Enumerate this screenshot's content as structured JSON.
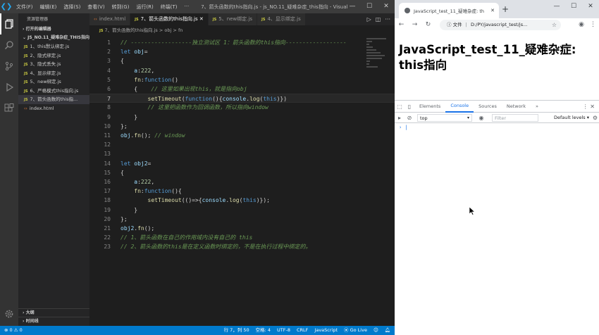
{
  "vscode": {
    "menu": [
      "文件(F)",
      "编辑(E)",
      "选择(S)",
      "查看(V)",
      "转到(G)",
      "运行(R)",
      "终端(T)",
      "···"
    ],
    "window_title": "7、箭头函数的this指向.js - js_NO.11_疑难杂症_this指向 - Visual St...",
    "sidebar": {
      "header": "资源管理器",
      "open_editors": "打开的编辑器",
      "folder": "JS_NO.11_疑难杂症_THIS指向",
      "files": [
        "1、this默认绑定.js",
        "2、隐式绑定.js",
        "3、隐式丢失.js",
        "4、显示绑定.js",
        "5、new绑定.js",
        "6、严格模式this指向.js",
        "7、箭头函数的this指...",
        "index.html"
      ],
      "outline": "大纲",
      "timeline": "时间线"
    },
    "tabs": [
      {
        "label": "index.html",
        "kind": "html"
      },
      {
        "label": "7、箭头函数的this指向.js",
        "kind": "js"
      },
      {
        "label": "5、new绑定.js",
        "kind": "js"
      },
      {
        "label": "4、显示绑定.js",
        "kind": "js"
      }
    ],
    "breadcrumb": {
      "file": "7、箭头函数的this指向.js",
      "sep": ">",
      "symbol": "obj",
      "leaf": "fn"
    },
    "code_lines": [
      {
        "n": "1",
        "text": "// ------------------独立测试区 1：箭头函数的this指向------------------"
      },
      {
        "n": "2",
        "text": "let obj="
      },
      {
        "n": "3",
        "text": "{"
      },
      {
        "n": "4",
        "text": "    a:222,"
      },
      {
        "n": "5",
        "text": "    fn:function()"
      },
      {
        "n": "6",
        "text": "    {    // 这里如果出现this，就是指向obj"
      },
      {
        "n": "7",
        "text": "        setTimeout(function(){console.log(this)})"
      },
      {
        "n": "8",
        "text": "        // 这里把函数作为回调函数，所以指向window"
      },
      {
        "n": "9",
        "text": "    }"
      },
      {
        "n": "10",
        "text": "};"
      },
      {
        "n": "11",
        "text": "obj.fn(); // window"
      },
      {
        "n": "12",
        "text": ""
      },
      {
        "n": "13",
        "text": ""
      },
      {
        "n": "14",
        "text": "let obj2="
      },
      {
        "n": "15",
        "text": "{"
      },
      {
        "n": "16",
        "text": "    a:222,"
      },
      {
        "n": "17",
        "text": "    fn:function(){"
      },
      {
        "n": "18",
        "text": "        setTimeout(()=>{console.log(this)});"
      },
      {
        "n": "19",
        "text": "    }"
      },
      {
        "n": "20",
        "text": "};"
      },
      {
        "n": "21",
        "text": "obj2.fn();"
      },
      {
        "n": "22",
        "text": "// 1、箭头函数在自己的作用域内没有自己的 this"
      },
      {
        "n": "23",
        "text": "// 2、箭头函数的this是在定义函数时绑定的，不是在执行过程中绑定的。"
      }
    ],
    "status": {
      "errors": "⊗ 0 ⚠ 0",
      "position": "行 7，列 50",
      "indent": "空格: 4",
      "encoding": "UTF-8",
      "eol": "CRLF",
      "language": "JavaScript",
      "golive": "Go Live"
    }
  },
  "chrome": {
    "tab_title": "JavaScript_test_11_疑难杂症: th",
    "new_tab": "+",
    "address_prefix": "文件",
    "address": "D:/PY/javascript_test/js...",
    "page_heading": "JavaScript_test_11_疑难杂症: this指向",
    "devtools": {
      "tabs": [
        "Elements",
        "Console",
        "Sources",
        "Network"
      ],
      "more": "»",
      "context": "top",
      "filter_placeholder": "Filter",
      "levels": "Default levels ▾",
      "prompt": "› |"
    }
  }
}
